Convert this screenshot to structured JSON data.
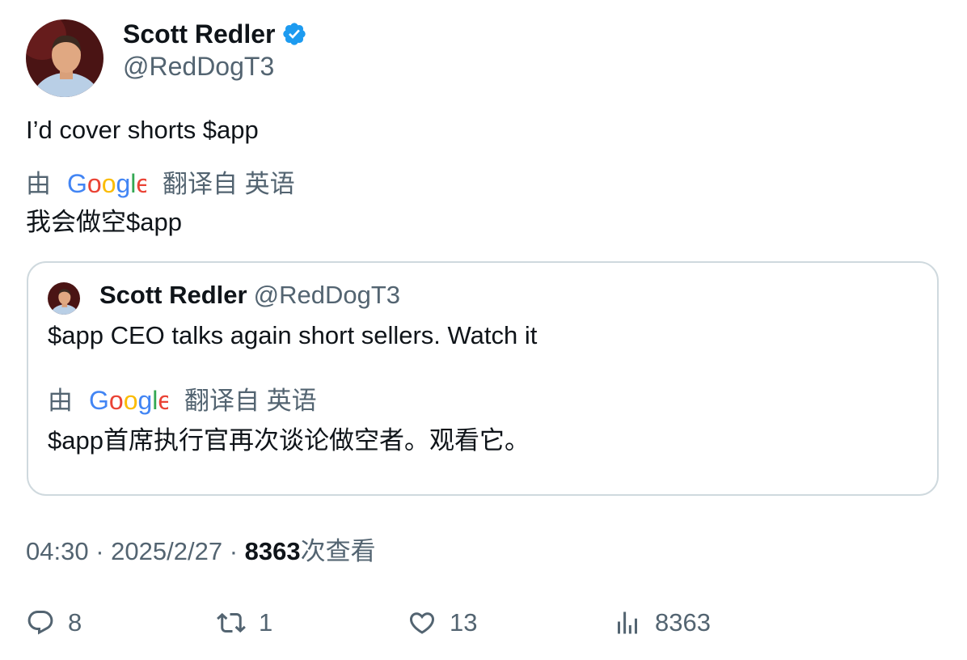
{
  "author": {
    "name": "Scott Redler",
    "handle": "@RedDogT3"
  },
  "tweet": {
    "text": "I’d cover shorts $app",
    "translation_prefix": "由",
    "translation_source": "翻译自 英语",
    "translated_text": "我会做空$app"
  },
  "quote": {
    "name": "Scott Redler",
    "handle": "@RedDogT3",
    "text": "$app CEO talks again short sellers. Watch it",
    "translation_prefix": "由",
    "translation_source": "翻译自 英语",
    "translated_text": "$app首席执行官再次谈论做空者。观看它。"
  },
  "meta": {
    "time": "04:30",
    "date": "2025/2/27",
    "views": "8363",
    "views_suffix": "次查看",
    "separator": "·"
  },
  "actions": {
    "replies": "8",
    "reposts": "1",
    "likes": "13",
    "views": "8363"
  },
  "colors": {
    "verified": "#1d9bf0",
    "secondary_text": "#536471",
    "border": "#cfd9de"
  },
  "icons": [
    "verified-badge-icon",
    "google-logo",
    "reply-icon",
    "repost-icon",
    "like-icon",
    "views-icon"
  ]
}
